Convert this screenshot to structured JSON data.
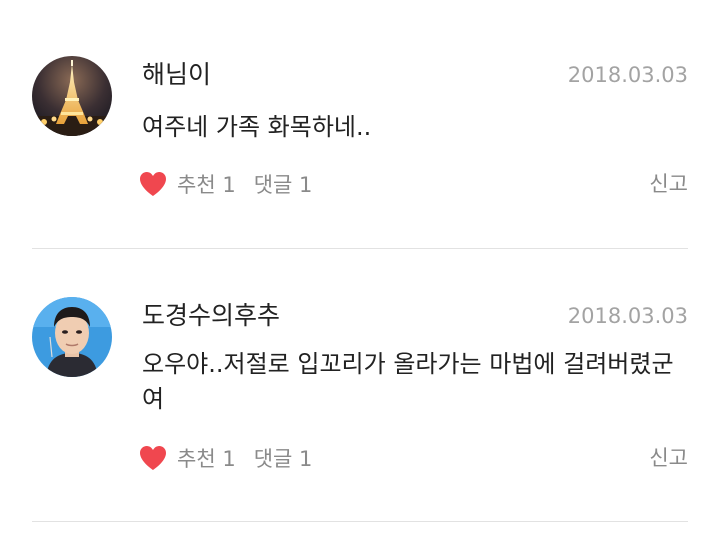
{
  "comments": [
    {
      "author": "해님이",
      "date": "2018.03.03",
      "text": "여주네 가족 화목하네..",
      "like_label": "추천 1",
      "reply_label": "댓글 1",
      "report_label": "신고",
      "avatar_icon": "eiffel-tower-photo"
    },
    {
      "author": "도경수의후추",
      "date": "2018.03.03",
      "text": "오우야..저절로 입꼬리가 올라가는 마법에 걸려버렸군여",
      "like_label": "추천 1",
      "reply_label": "댓글 1",
      "report_label": "신고",
      "avatar_icon": "person-photo"
    }
  ],
  "colors": {
    "heart": "#f0474f",
    "date": "#a3a3a3",
    "meta": "#8a8a8a",
    "divider": "#e2e2e2"
  }
}
